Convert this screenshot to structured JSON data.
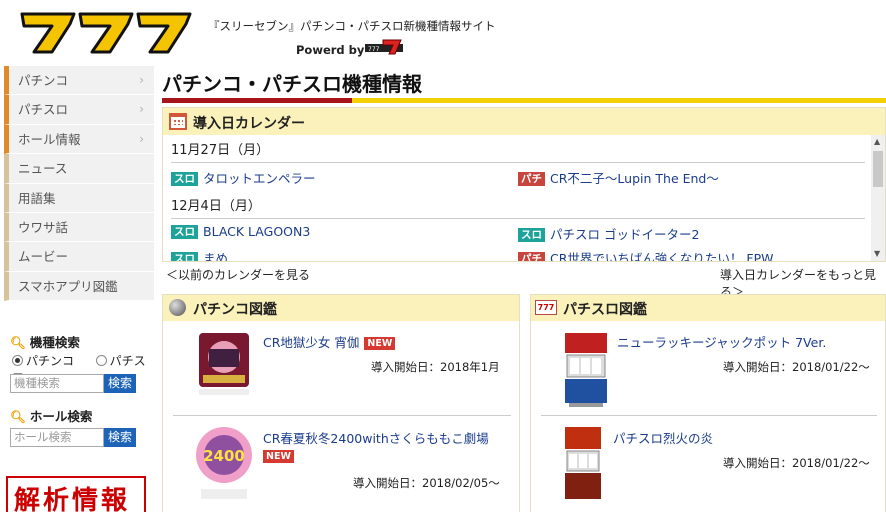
{
  "header": {
    "tagline": "『スリーセブン』パチンコ・パチスロ新機種情報サイト",
    "powered": "Powerd by",
    "colors": {
      "logo_fill": "#f5c400",
      "logo_stroke": "#111111"
    }
  },
  "sidebar": {
    "nav": [
      {
        "label": "パチンコ",
        "has_arrow": true
      },
      {
        "label": "パチスロ",
        "has_arrow": true
      },
      {
        "label": "ホール情報",
        "has_arrow": true
      },
      {
        "label": "ニュース",
        "has_arrow": false
      },
      {
        "label": "用語集",
        "has_arrow": false
      },
      {
        "label": "ウワサ話",
        "has_arrow": false
      },
      {
        "label": "ムービー",
        "has_arrow": false
      },
      {
        "label": "スマホアプリ図鑑",
        "has_arrow": false
      }
    ],
    "machine_search": {
      "title": "機種検索",
      "option_pachinko": "パチンコ",
      "option_pachislot": "パチスロ",
      "selected": "パチンコ",
      "placeholder": "機種検索",
      "button": "検索"
    },
    "hall_search": {
      "title": "ホール検索",
      "placeholder": "ホール検索",
      "button": "検索"
    },
    "banner": "解析情報"
  },
  "main": {
    "page_title": "パチンコ・パチスロ機種情報",
    "calendar": {
      "title": "導入日カレンダー",
      "groups": [
        {
          "date": "11月27日（月）",
          "entries": [
            {
              "tag": "スロ",
              "name": "タロットエンペラー"
            },
            {
              "tag": "パチ",
              "name": "CR不二子～Lupin The End～"
            }
          ]
        },
        {
          "date": "12月4日（月）",
          "entries": [
            {
              "tag": "スロ",
              "name": "BLACK LAGOON3"
            },
            {
              "tag": "スロ",
              "name": "パチスロ ゴッドイーター2"
            },
            {
              "tag": "スロ",
              "name": "まめ"
            },
            {
              "tag": "パチ",
              "name": "CR世界でいちばん強くなりたい！ FPW"
            }
          ]
        }
      ],
      "prev_link": "＜以前のカレンダーを見る",
      "more_link": "導入日カレンダーをもっと見る＞"
    },
    "pachinko_zukan": {
      "title": "パチンコ図鑑",
      "items": [
        {
          "name": "CR地獄少女 宵伽",
          "new_badge": "NEW",
          "date": "導入開始日：2018年1月"
        },
        {
          "name": "CR春夏秋冬2400withさくらももこ劇場",
          "new_badge": "NEW",
          "date": "導入開始日：2018/02/05～"
        }
      ]
    },
    "pachislot_zukan": {
      "title": "パチスロ図鑑",
      "items": [
        {
          "name": "ニューラッキージャックポット 7Ver.",
          "date": "導入開始日：2018/01/22～"
        },
        {
          "name": "パチスロ烈火の炎",
          "date": "導入開始日：2018/01/22～"
        }
      ]
    }
  }
}
